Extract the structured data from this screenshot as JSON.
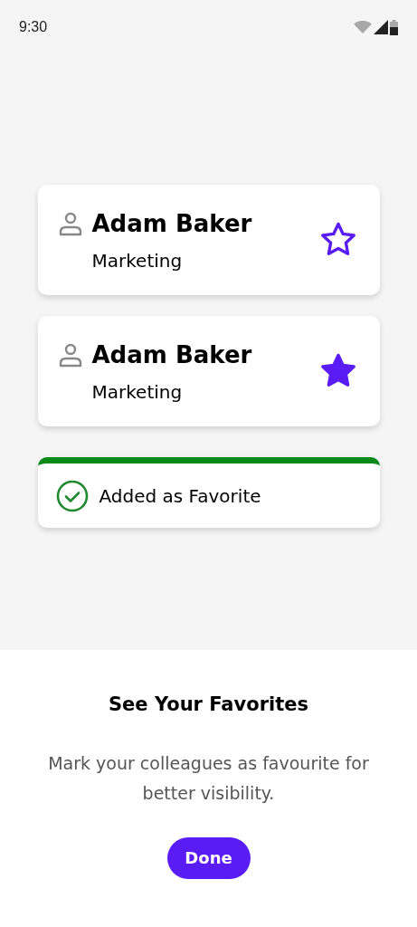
{
  "status_bar": {
    "time": "9:30"
  },
  "contacts": [
    {
      "name": "Adam Baker",
      "department": "Marketing",
      "favorite": false
    },
    {
      "name": "Adam Baker",
      "department": "Marketing",
      "favorite": true
    }
  ],
  "toast": {
    "message": "Added as Favorite"
  },
  "sheet": {
    "title": "See Your Favorites",
    "description": "Mark your colleagues as favourite for better visibility.",
    "button": "Done"
  }
}
